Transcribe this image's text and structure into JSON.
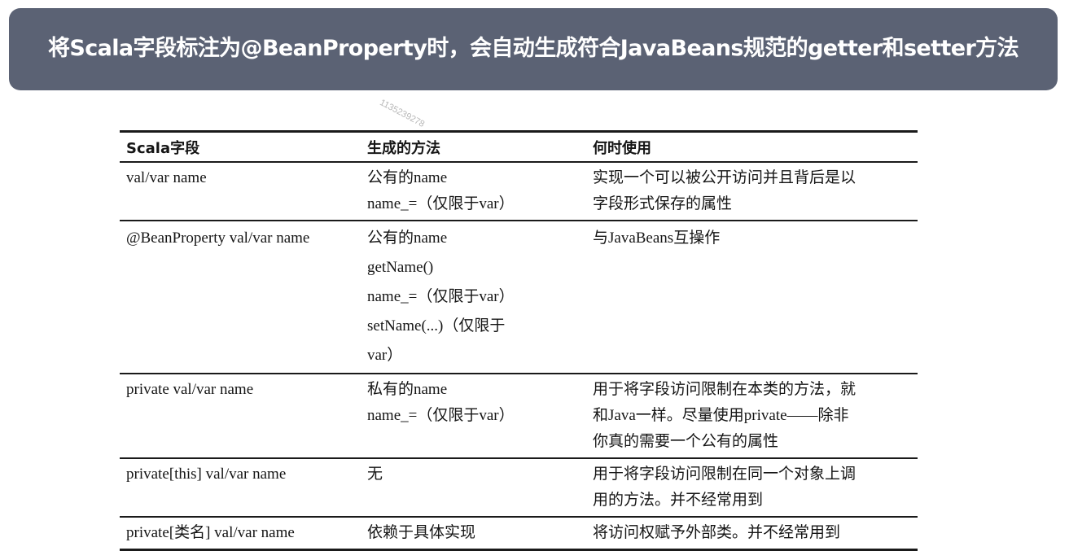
{
  "banner": {
    "title": "将Scala字段标注为@BeanProperty时，会自动生成符合JavaBeans规范的getter和setter方法"
  },
  "watermark": "1135239278",
  "table": {
    "headers": [
      "Scala字段",
      "生成的方法",
      "何时使用"
    ],
    "rows": [
      {
        "field": "val/var name",
        "methods": [
          "公有的name",
          "name_=（仅限于var）"
        ],
        "usage": [
          "实现一个可以被公开访问并且背后是以",
          "字段形式保存的属性"
        ]
      },
      {
        "field": "@BeanProperty val/var name",
        "methods": [
          "公有的name",
          "getName()",
          "name_=（仅限于var）",
          "setName(...)（仅限于",
          "var）"
        ],
        "usage": [
          "与JavaBeans互操作"
        ]
      },
      {
        "field": "private val/var name",
        "methods": [
          "私有的name",
          "name_=（仅限于var）"
        ],
        "usage": [
          "用于将字段访问限制在本类的方法，就",
          "和Java一样。尽量使用private——除非",
          "你真的需要一个公有的属性"
        ]
      },
      {
        "field": "private[this] val/var name",
        "methods": [
          "无"
        ],
        "usage": [
          "用于将字段访问限制在同一个对象上调",
          "用的方法。并不经常用到"
        ]
      },
      {
        "field": "private[类名] val/var name",
        "methods": [
          "依赖于具体实现"
        ],
        "usage": [
          "将访问权赋予外部类。并不经常用到"
        ]
      }
    ]
  }
}
